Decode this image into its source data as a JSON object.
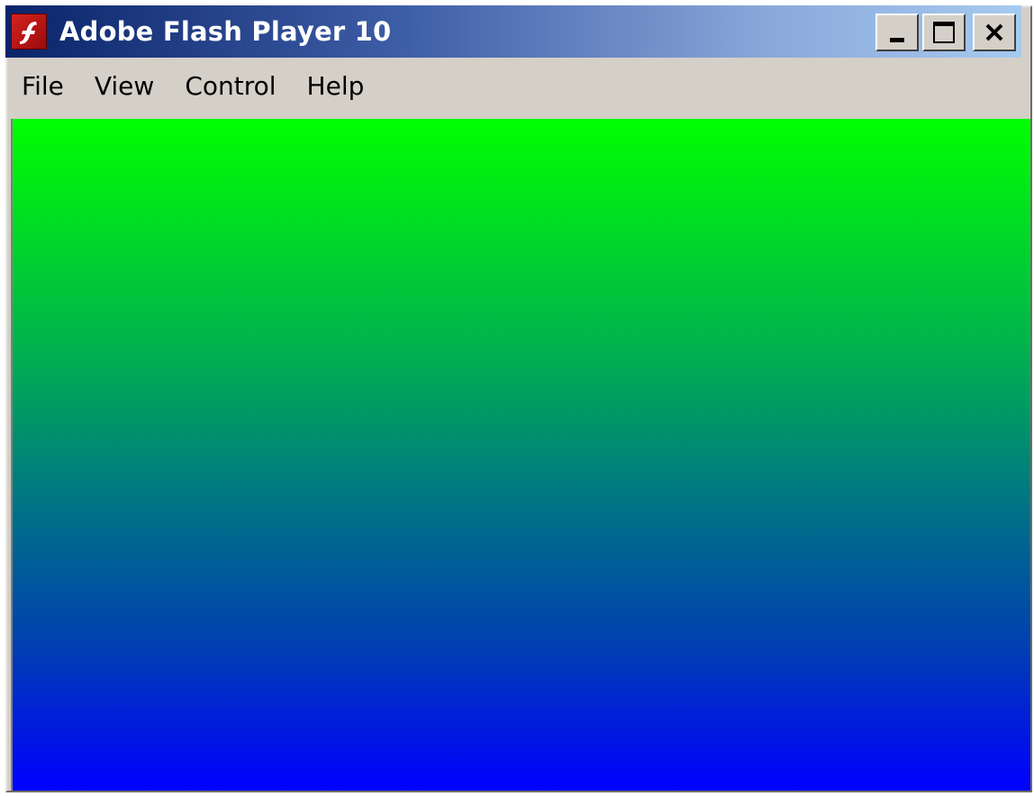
{
  "window": {
    "title": "Adobe Flash Player 10",
    "app_icon": "flash-icon",
    "controls": {
      "minimize_icon": "minimize-icon",
      "maximize_icon": "maximize-icon",
      "close_icon": "close-icon",
      "close_glyph": "✕"
    }
  },
  "menubar": {
    "items": [
      {
        "label": "File"
      },
      {
        "label": "View"
      },
      {
        "label": "Control"
      },
      {
        "label": "Help"
      }
    ]
  },
  "stage": {
    "gradient_top_color": "#00ff00",
    "gradient_bottom_color": "#0000ff"
  }
}
